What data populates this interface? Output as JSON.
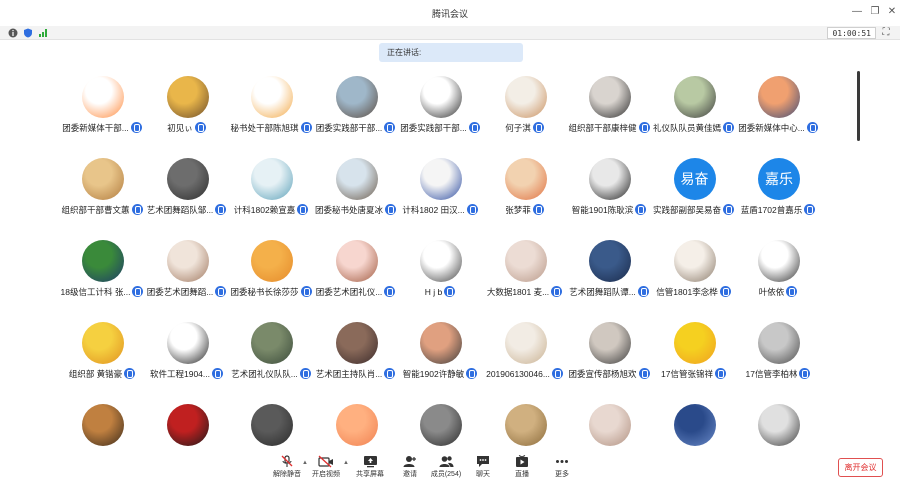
{
  "window": {
    "title": "腾讯会议",
    "minimize_icon": "minimize-icon",
    "maximize_icon": "restore-icon",
    "close_icon": "close-icon"
  },
  "status": {
    "timer": "01:00:51"
  },
  "speaking": {
    "label": "正在讲话:"
  },
  "participants": [
    {
      "name": "团委新媒体干部...",
      "c1": "#ffffff",
      "c2": "#ff8a3d"
    },
    {
      "name": "初见ぃ",
      "c1": "#e9b64a",
      "c2": "#6b4b2a"
    },
    {
      "name": "秘书处干部陈旭琪",
      "c1": "#ffffff",
      "c2": "#f2a845"
    },
    {
      "name": "团委实践部干部...",
      "c1": "#9fb7c9",
      "c2": "#5a4a3f"
    },
    {
      "name": "团委实践部干部...",
      "c1": "#ffffff",
      "c2": "#2a2a2a"
    },
    {
      "name": "何子淇",
      "c1": "#f3eee6",
      "c2": "#c98f5d"
    },
    {
      "name": "组织部干部康梓健",
      "c1": "#d9d4cf",
      "c2": "#2b2b2b"
    },
    {
      "name": "礼仪队队员黄佳嫣",
      "c1": "#b8c9a3",
      "c2": "#3b3b3b"
    },
    {
      "name": "团委新媒体中心...",
      "c1": "#f0a070",
      "c2": "#3d4b78"
    },
    {
      "name": "组织部干部曹文蕙",
      "c1": "#e8c58a",
      "c2": "#b07a3d"
    },
    {
      "name": "艺术团舞蹈队邹...",
      "c1": "#6d6d6d",
      "c2": "#2d2d2d"
    },
    {
      "name": "计科1802赖宣嘉",
      "c1": "#e6f1f5",
      "c2": "#5aa0b8"
    },
    {
      "name": "团委秘书处唐夏冰",
      "c1": "#d7e3ec",
      "c2": "#6a5a4a"
    },
    {
      "name": "计科1802  田汉...",
      "c1": "#f5f5f5",
      "c2": "#2a4aa0"
    },
    {
      "name": "张梦菲",
      "c1": "#f2d2b0",
      "c2": "#e07040"
    },
    {
      "name": "智能1901陈耿滨",
      "c1": "#e8e8e8",
      "c2": "#1e1e1e"
    },
    {
      "name": "实践部副部吴易奋",
      "text": "易奋",
      "c1": "#1d86e8",
      "c2": "#1d86e8"
    },
    {
      "name": "蓝盾1702曾嘉乐",
      "text": "嘉乐",
      "c1": "#1d86e8",
      "c2": "#1d86e8"
    },
    {
      "name": "18级信工计科  张...",
      "c1": "#3a8a3a",
      "c2": "#1d3a6a"
    },
    {
      "name": "团委艺术团舞蹈...",
      "c1": "#f0e4da",
      "c2": "#a07860"
    },
    {
      "name": "团委秘书长徐莎莎",
      "c1": "#f4b04a",
      "c2": "#e58a2a"
    },
    {
      "name": "团委艺术团礼仪...",
      "c1": "#f7d6cf",
      "c2": "#a05a40"
    },
    {
      "name": "H  j  b",
      "c1": "#ffffff",
      "c2": "#404040"
    },
    {
      "name": "大数据1801  麦...",
      "c1": "#ecdcd4",
      "c2": "#b89888"
    },
    {
      "name": "艺术团舞蹈队谭...",
      "c1": "#3a5a8a",
      "c2": "#1a2a4a"
    },
    {
      "name": "信管1801李念桦",
      "c1": "#f5efe8",
      "c2": "#8a7a6a"
    },
    {
      "name": "叶依依",
      "c1": "#ffffff",
      "c2": "#303030"
    },
    {
      "name": "组织部  黄锴豪",
      "c1": "#f5d040",
      "c2": "#e09020"
    },
    {
      "name": "软件工程1904...",
      "c1": "#ffffff",
      "c2": "#202020"
    },
    {
      "name": "艺术团礼仪队队...",
      "c1": "#7a8a6a",
      "c2": "#3a4a3a"
    },
    {
      "name": "艺术团主持队肖...",
      "c1": "#8a6a5a",
      "c2": "#3a2a2a"
    },
    {
      "name": "智能1902许静敏",
      "c1": "#e0a080",
      "c2": "#3a3a3a"
    },
    {
      "name": "201906130046...",
      "c1": "#f2ece4",
      "c2": "#c8b090"
    },
    {
      "name": "团委宣传部杨旭欢",
      "c1": "#d0c8c0",
      "c2": "#3a3a3a"
    },
    {
      "name": "17信管张锦祥",
      "c1": "#f5d020",
      "c2": "#f0a020"
    },
    {
      "name": "17信管李柏林",
      "c1": "#c8c8c8",
      "c2": "#4a4a4a"
    },
    {
      "name": "",
      "c1": "#c08040",
      "c2": "#3a2a1a"
    },
    {
      "name": "",
      "c1": "#c02020",
      "c2": "#1a1a1a"
    },
    {
      "name": "",
      "c1": "#5a5a5a",
      "c2": "#2a2a2a"
    },
    {
      "name": "",
      "c1": "#ffb080",
      "c2": "#f08050"
    },
    {
      "name": "",
      "c1": "#8a8a8a",
      "c2": "#2a2a2a"
    },
    {
      "name": "",
      "c1": "#d0b080",
      "c2": "#8a6a3a"
    },
    {
      "name": "",
      "c1": "#e8d8d0",
      "c2": "#b09080"
    },
    {
      "name": "",
      "c1": "#2a4a8a",
      "c2": "#6a8ac8"
    },
    {
      "name": "",
      "c1": "#e0e0e0",
      "c2": "#3a3a3a"
    }
  ],
  "toolbar": {
    "mute": "解除静音",
    "video": "开启视频",
    "share": "共享屏幕",
    "invite": "邀请",
    "members": "成员(254)",
    "chat": "聊天",
    "live": "直播",
    "more": "更多",
    "leave": "离开会议"
  },
  "colors": {
    "accent": "#2f6ee0",
    "danger": "#e03030",
    "mic_off": "#e03030"
  }
}
